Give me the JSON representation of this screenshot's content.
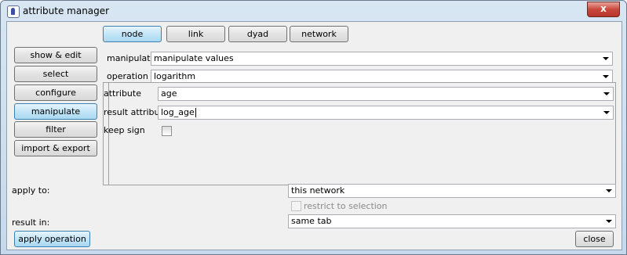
{
  "window": {
    "title": "attribute manager",
    "close_glyph": "x"
  },
  "tabs": [
    {
      "label": "node",
      "active": true
    },
    {
      "label": "link",
      "active": false
    },
    {
      "label": "dyad",
      "active": false
    },
    {
      "label": "network",
      "active": false
    }
  ],
  "sidebar": [
    {
      "label": "show & edit",
      "active": false
    },
    {
      "label": "select",
      "active": false
    },
    {
      "label": "configure",
      "active": false
    },
    {
      "label": "manipulate",
      "active": true
    },
    {
      "label": "filter",
      "active": false
    },
    {
      "label": "import & export",
      "active": false
    }
  ],
  "manipulate": {
    "label": "manipulate",
    "value": "manipulate values"
  },
  "operation": {
    "label": "operation",
    "value": "logarithm"
  },
  "attribute": {
    "label": "attribute",
    "value": "age"
  },
  "result_attribute": {
    "label": "result attribute",
    "value": "log_age"
  },
  "keep_sign": {
    "label": "keep sign",
    "checked": false
  },
  "apply_to": {
    "label": "apply to:",
    "value": "this network"
  },
  "restrict": {
    "label": "restrict to selection",
    "checked": false,
    "enabled": false
  },
  "result_in": {
    "label": "result in:",
    "value": "same tab"
  },
  "buttons": {
    "apply": "apply operation",
    "close": "close"
  }
}
